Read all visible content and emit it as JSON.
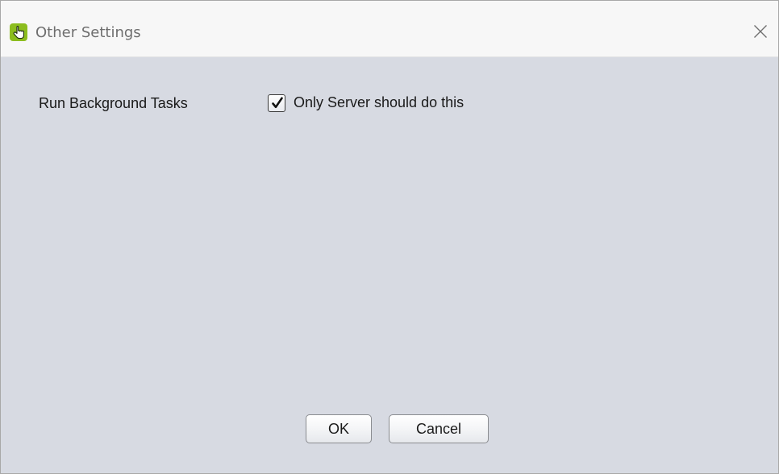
{
  "window": {
    "title": "Other Settings",
    "icon": "app-hand-icon",
    "accent_color": "#8cbd1e",
    "background_color": "#d7dae2"
  },
  "settings": {
    "run_background_tasks_label": "Run Background Tasks",
    "only_server_checkbox": {
      "label": "Only Server should do this",
      "checked": true
    }
  },
  "buttons": {
    "ok_label": "OK",
    "cancel_label": "Cancel"
  }
}
